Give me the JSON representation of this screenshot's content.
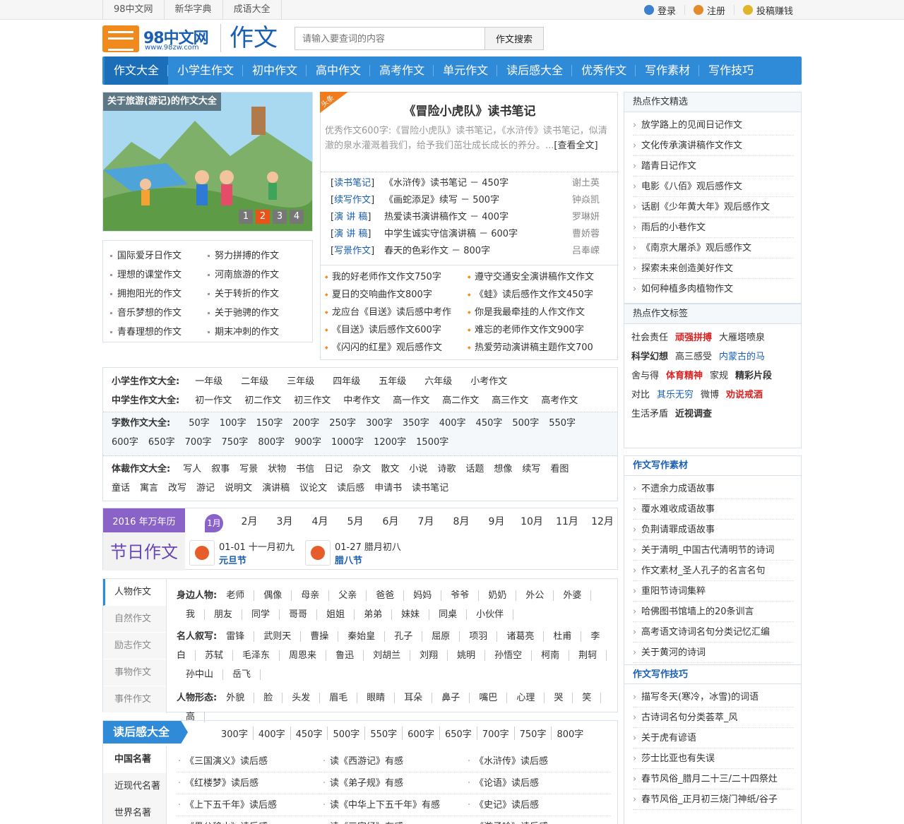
{
  "topbar": {
    "links": [
      "98中文网",
      "新华字典",
      "成语大全"
    ],
    "login": "登录",
    "register": "注册",
    "contribute": "投稿赚钱"
  },
  "header": {
    "logo_name": "98中文网",
    "logo_url": "www.98zw.com",
    "section": "作文",
    "search_placeholder": "请输入要查词的内容",
    "search_button": "作文搜索"
  },
  "nav": [
    "作文大全",
    "小学生作文",
    "初中作文",
    "高中作文",
    "高考作文",
    "单元作文",
    "读后感大全",
    "优秀作文",
    "写作素材",
    "写作技巧"
  ],
  "slider": {
    "caption": "关于旅游(游记)的作文大全",
    "pages": [
      "1",
      "2",
      "3",
      "4"
    ],
    "active_page": "2"
  },
  "left_links": [
    [
      "国际爱牙日作文",
      "努力拼搏的作文"
    ],
    [
      "理想的课堂作文",
      "河南旅游的作文"
    ],
    [
      "拥抱阳光的作文",
      "关于转折的作文"
    ],
    [
      "音乐梦想的作文",
      "关于驰骋的作文"
    ],
    [
      "青春理想的作文",
      "期末冲刺的作文"
    ]
  ],
  "headline": {
    "badge": "头条",
    "title": "《冒险小虎队》读书笔记",
    "summary": "优秀作文600字:《冒险小虎队》读书笔记，《水浒传》读书笔记，似清澈的泉水灌溉着我们，给予我们茁壮成长成长的养分。...",
    "more": "[查看全文]"
  },
  "cat_list": [
    {
      "tag": "读书笔记",
      "title": "《水浒传》读书笔记 － 450字",
      "author": "谢土英"
    },
    {
      "tag": "续写作文",
      "title": "《画蛇添足》续写 － 500字",
      "author": "钟焱凯"
    },
    {
      "tag": "演 讲 稿",
      "title": "热爱读书演讲稿作文 － 400字",
      "author": "罗琳妍"
    },
    {
      "tag": "演 讲 稿",
      "title": "中学生诚实守信演讲稿 － 600字",
      "author": "曹娇蓉"
    },
    {
      "tag": "写景作文",
      "title": "春天的色彩作文 － 800字",
      "author": "吕奉嵘"
    }
  ],
  "two_col": [
    [
      "我的好老师作文作文750字",
      "遵守交通安全演讲稿作文作文"
    ],
    [
      "夏日的交响曲作文800字",
      "《蛙》读后感作文作文450字"
    ],
    [
      "龙应台《目送》读后感中考作",
      "你是我最牵挂的人作文作文"
    ],
    [
      "《目送》读后感作文600字",
      "难忘的老师作文作文900字"
    ],
    [
      "《闪闪的红星》观后感作文",
      "热爱劳动演讲稿主题作文700"
    ]
  ],
  "hot_essays": {
    "title": "热点作文精选",
    "items": [
      "放学路上的见闻日记作文",
      "文化传承演讲稿作文作文",
      "踏青日记作文",
      "电影《八佰》观后感作文",
      "话剧《少年黄大年》观后感作文",
      "雨后的小巷作文",
      "《南京大屠杀》观后感作文",
      "探索未来创造美好作文",
      "如何种植多肉植物作文"
    ]
  },
  "hot_tags": {
    "title": "热点作文标签",
    "tags": [
      {
        "t": "社会责任",
        "s": ""
      },
      {
        "t": "顽强拼搏",
        "s": "red"
      },
      {
        "t": "大雁塔喷泉",
        "s": ""
      },
      {
        "t": "科学幻想",
        "s": "bk"
      },
      {
        "t": "高三感受",
        "s": ""
      },
      {
        "t": "内蒙古的马",
        "s": "bl"
      },
      {
        "t": "舍与得",
        "s": ""
      },
      {
        "t": "体育精神",
        "s": "red"
      },
      {
        "t": "家规",
        "s": ""
      },
      {
        "t": "精彩片段",
        "s": "bk"
      },
      {
        "t": "对比",
        "s": ""
      },
      {
        "t": "其乐无穷",
        "s": "bl"
      },
      {
        "t": "微博",
        "s": ""
      },
      {
        "t": "劝说戒酒",
        "s": "red"
      },
      {
        "t": "生活矛盾",
        "s": ""
      },
      {
        "t": "近视调查",
        "s": "bk"
      }
    ]
  },
  "material": {
    "title": "作文写作素材",
    "items": [
      "不遗余力成语故事",
      "覆水难收成语故事",
      "负荆请罪成语故事",
      "关于清明_中国古代清明节的诗词",
      "作文素材_圣人孔子的名言名句",
      "重阳节诗词集粹",
      "哈佛图书馆墙上的20条训言",
      "高考语文诗词名句分类记忆汇编",
      "关于黄河的诗词"
    ]
  },
  "skills": {
    "title": "作文写作技巧",
    "items": [
      "描写冬天(寒冷，冰雪)的词语",
      "古诗词名句分类荟萃_风",
      "关于虎有谚语",
      "莎士比亚也有失误",
      "春节风俗_腊月二十三/二十四祭灶",
      "春节风俗_正月初三烧门神纸/谷子"
    ]
  },
  "grades": {
    "primary_label": "小学生作文大全:",
    "primary": [
      "一年级",
      "二年级",
      "三年级",
      "四年级",
      "五年级",
      "六年级",
      "小考作文"
    ],
    "middle_label": "中学生作文大全:",
    "middle": [
      "初一作文",
      "初二作文",
      "初三作文",
      "中考作文",
      "高一作文",
      "高二作文",
      "高三作文",
      "高考作文"
    ],
    "words_label": "字数作文大全:",
    "words": [
      "50字",
      "100字",
      "150字",
      "200字",
      "250字",
      "300字",
      "350字",
      "400字",
      "450字",
      "500字",
      "550字",
      "600字",
      "650字",
      "700字",
      "750字",
      "800字",
      "900字",
      "1000字",
      "1200字",
      "1500字"
    ],
    "genre_label": "体裁作文大全:",
    "genres": [
      "写人",
      "叙事",
      "写景",
      "状物",
      "书信",
      "日记",
      "杂文",
      "散文",
      "小说",
      "诗歌",
      "话题",
      "想像",
      "续写",
      "看图",
      "童话",
      "寓言",
      "改写",
      "游记",
      "说明文",
      "演讲稿",
      "议论文",
      "读后感",
      "申请书",
      "读书笔记"
    ]
  },
  "calendar": {
    "year_label": "2016 年万年历",
    "title": "节日作文",
    "months": [
      "1月",
      "2月",
      "3月",
      "4月",
      "5月",
      "6月",
      "7月",
      "8月",
      "9月",
      "10月",
      "11月",
      "12月"
    ],
    "active_month": "1月",
    "festivals": [
      {
        "date": "01-01 十一月初九",
        "name": "元旦节"
      },
      {
        "date": "01-27 腊月初八",
        "name": "腊八节"
      }
    ]
  },
  "people": {
    "tabs": [
      "人物作文",
      "自然作文",
      "励志作文",
      "事物作文",
      "事件作文"
    ],
    "active_tab": "人物作文",
    "around_label": "身边人物:",
    "around": [
      "老师",
      "偶像",
      "母亲",
      "父亲",
      "爸爸",
      "妈妈",
      "爷爷",
      "奶奶",
      "外公",
      "外婆",
      "我",
      "朋友",
      "同学",
      "哥哥",
      "姐姐",
      "弟弟",
      "妹妹",
      "同桌",
      "小伙伴"
    ],
    "famous_label": "名人叙写:",
    "famous": [
      "雷锋",
      "武则天",
      "曹操",
      "秦始皇",
      "孔子",
      "屈原",
      "项羽",
      "诸葛亮",
      "杜甫",
      "李白",
      "苏轼",
      "毛泽东",
      "周恩来",
      "鲁迅",
      "刘胡兰",
      "刘翔",
      "姚明",
      "孙悟空",
      "柯南",
      "荆轲",
      "孙中山",
      "岳飞"
    ],
    "form_label": "人物形态:",
    "form": [
      "外貌",
      "脸",
      "头发",
      "眉毛",
      "眼睛",
      "耳朵",
      "鼻子",
      "嘴巴",
      "心理",
      "哭",
      "笑",
      "高"
    ]
  },
  "reading": {
    "title": "读后感大全",
    "words": [
      "300字",
      "400字",
      "450字",
      "500字",
      "550字",
      "600字",
      "650字",
      "700字",
      "750字",
      "800字"
    ],
    "tabs": [
      "中国名著",
      "近现代名著",
      "世界名著"
    ],
    "active_tab": "中国名著",
    "items": [
      [
        "《三国演义》读后感",
        "读《西游记》有感",
        "《水浒传》读后感"
      ],
      [
        "《红楼梦》读后感",
        "读《弟子规》有感",
        "《论语》读后感"
      ],
      [
        "《上下五千年》读后感",
        "读《中华上下五千年》有感",
        "《史记》读后感"
      ],
      [
        "《愚公移山》读后感",
        "读《三字经》有感",
        "《游子吟》读后感"
      ]
    ]
  }
}
